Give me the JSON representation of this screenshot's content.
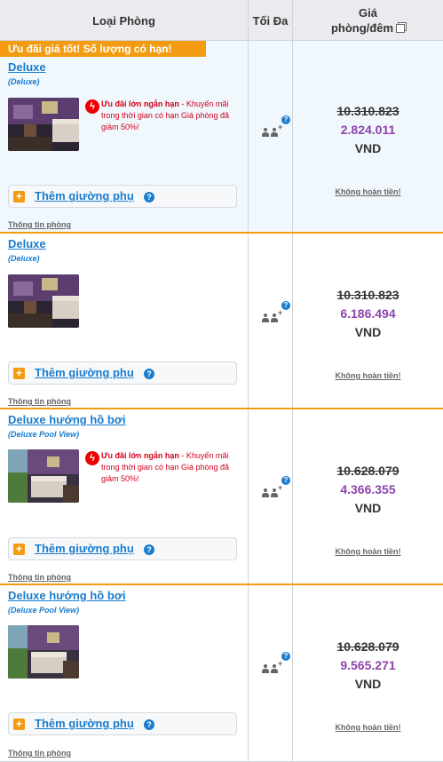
{
  "header": {
    "room_type": "Loại Phòng",
    "max": "Tối Đa",
    "price_line1": "Giá",
    "price_line2": "phòng/đêm"
  },
  "icons": {
    "copy": "copy-icon",
    "bolt": "lightning-icon",
    "plus": "plus-icon",
    "help": "question-icon",
    "occupancy": "adults-icon"
  },
  "colors": {
    "accent_orange": "#f39c12",
    "link_blue": "#1a7dcf",
    "price_purple": "#8e44ad",
    "deal_red": "#d0021b"
  },
  "rows": [
    {
      "promo_banner": "Ưu đãi giá tốt! Số lượng có hạn!",
      "name": "Deluxe",
      "sub": "(Deluxe)",
      "deal_title": "Ưu đãi lớn ngắn hạn",
      "deal_text": " - Khuyến mãi trong thời gian có hạn Giá phòng đã giảm 50%!",
      "extra_bed": "Thêm giường phụ",
      "room_info": "Thông tin phòng",
      "old_price": "10.310.823",
      "new_price": "2.824.011",
      "currency": "VND",
      "refund": "Không hoàn tiền!"
    },
    {
      "name": "Deluxe",
      "sub": "(Deluxe)",
      "extra_bed": "Thêm giường phụ",
      "room_info": "Thông tin phòng",
      "old_price": "10.310.823",
      "new_price": "6.186.494",
      "currency": "VND",
      "refund": "Không hoàn tiền!"
    },
    {
      "name": "Deluxe hướng hồ bơi",
      "sub": "(Deluxe Pool View)",
      "deal_title": "Ưu đãi lớn ngắn hạn",
      "deal_text": " - Khuyến mãi trong thời gian có hạn Giá phòng đã giảm 50%!",
      "extra_bed": "Thêm giường phụ",
      "room_info": "Thông tin phòng",
      "old_price": "10.628.079",
      "new_price": "4.366.355",
      "currency": "VND",
      "refund": "Không hoàn tiền!"
    },
    {
      "name": "Deluxe hướng hồ bơi",
      "sub": "(Deluxe Pool View)",
      "extra_bed": "Thêm giường phụ",
      "room_info": "Thông tin phòng",
      "old_price": "10.628.079",
      "new_price": "9.565.271",
      "currency": "VND",
      "refund": "Không hoàn tiền!"
    }
  ]
}
